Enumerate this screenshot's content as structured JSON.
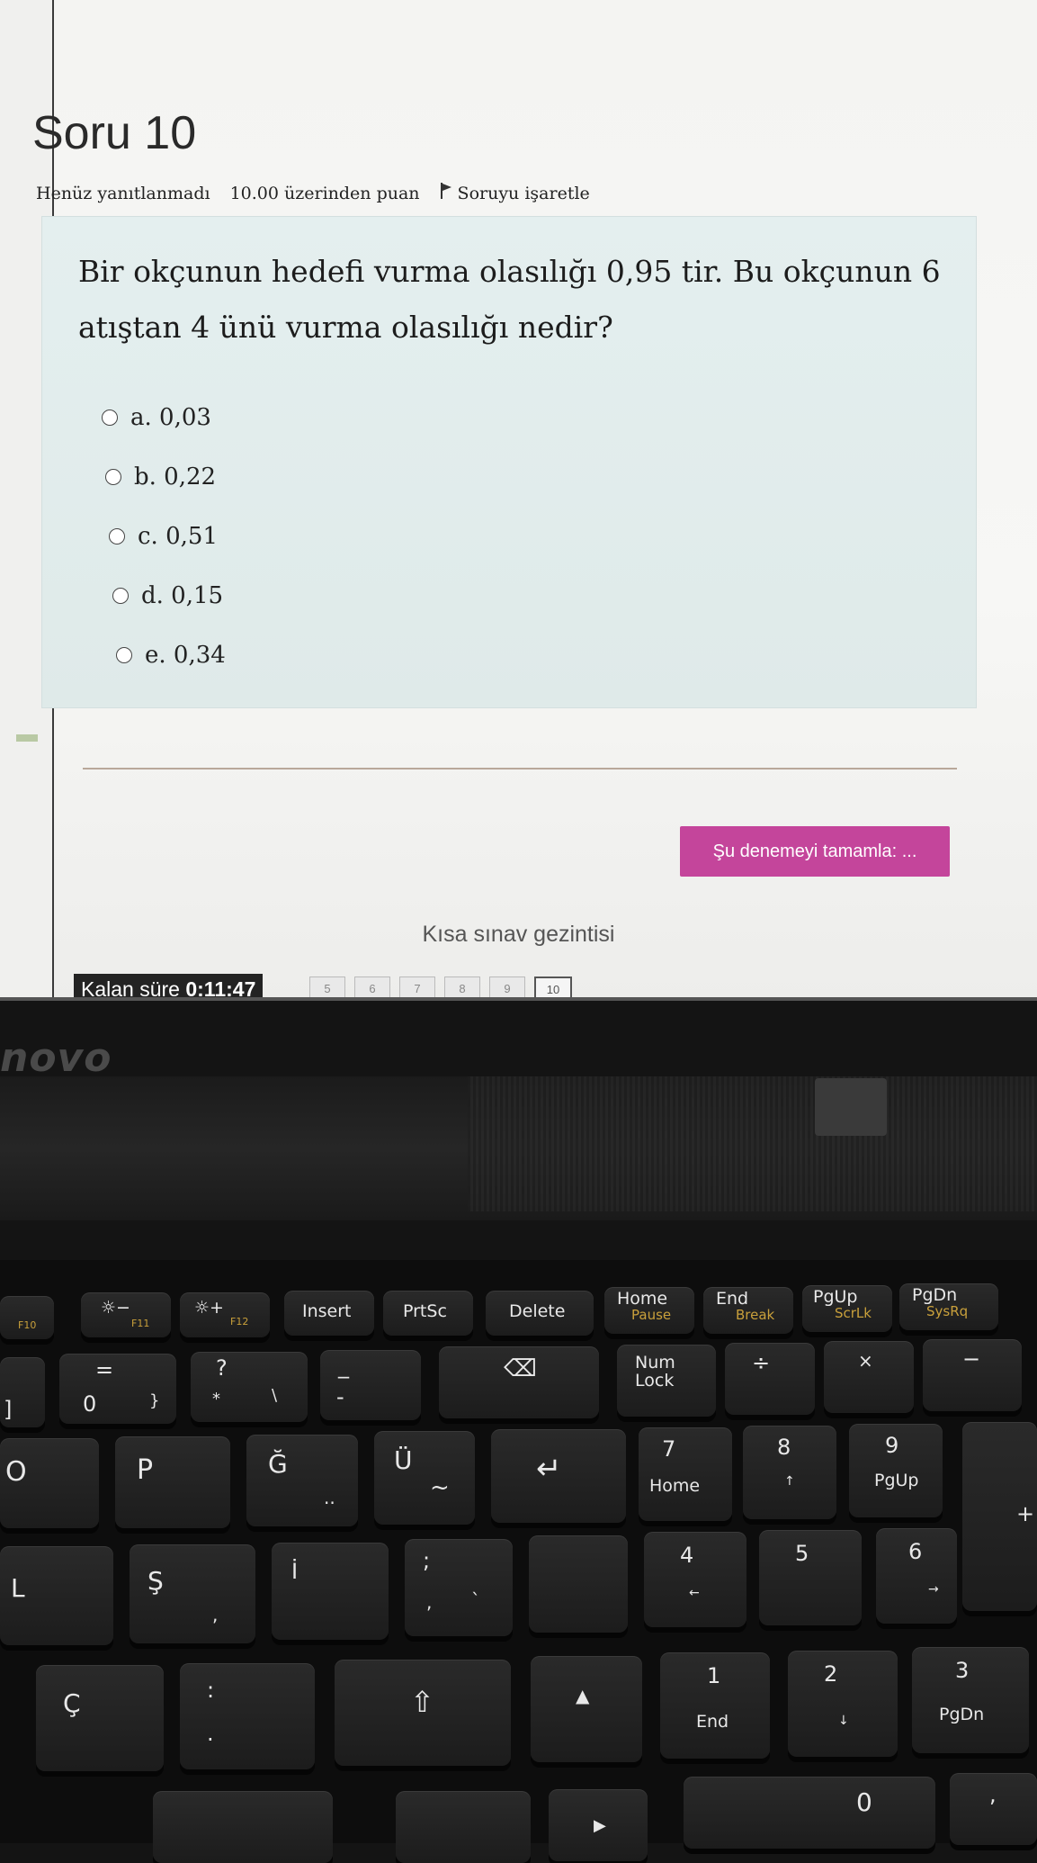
{
  "question": {
    "title": "Soru 10",
    "status": "Henüz yanıtlanmadı",
    "points": "10.00 üzerinden puan",
    "flag_label": "Soruyu işaretle",
    "text": "Bir okçunun hedefi vurma olasılığı 0,95 tir. Bu okçunun 6 atıştan 4 ünü vurma olasılığı nedir?",
    "answers": [
      {
        "label": "a. 0,03"
      },
      {
        "label": "b. 0,22"
      },
      {
        "label": "c. 0,51"
      },
      {
        "label": "d. 0,15"
      },
      {
        "label": "e. 0,34"
      }
    ]
  },
  "finish_button": "Şu denemeyi tamamla: ...",
  "quiz_nav": {
    "title": "Kısa sınav gezintisi",
    "timer_label": "Kalan süre",
    "timer_value": "0:11:47",
    "pages": [
      "5",
      "6",
      "7",
      "8",
      "9",
      "10"
    ]
  },
  "laptop": {
    "brand": "novo",
    "keys": {
      "f10": "F10",
      "f11": "F11",
      "f12": "F12",
      "insert": "Insert",
      "prtsc": "PrtSc",
      "delete": "Delete",
      "home_top": "Home",
      "pause": "Pause",
      "end_top": "End",
      "break": "Break",
      "pgup_top": "PgUp",
      "scrlk": "ScrLk",
      "pgdn_top": "PgDn",
      "sysrq": "SysRq",
      "eq": "=",
      "zero": "0",
      "brace1": "}",
      "q": "?",
      "star": "*",
      "bslash": "\\",
      "minus_top": "_",
      "dash": "-",
      "numlock": "Num Lock",
      "div": "÷",
      "mul": "×",
      "minus": "−",
      "o": "O",
      "p": "P",
      "gbreve": "Ğ",
      "udia": "Ü",
      "tilde": "~",
      "dots": "..",
      "n7": "7",
      "home": "Home",
      "n8": "8",
      "up": "↑",
      "n9": "9",
      "pgup": "PgUp",
      "plus": "+",
      "l": "L",
      "scedil": "Ş",
      "idot": "İ",
      "semi": ";",
      "comma": ",",
      "accent": "`",
      "n4": "4",
      "left": "←",
      "n5": "5",
      "n6": "6",
      "right": "→",
      "ccedil": "Ç",
      "colon": ":",
      "period": ".",
      "n1": "1",
      "end": "End",
      "n2": "2",
      "down": "↓",
      "n3": "3",
      "pgdn": "PgDn",
      "n0": "0",
      "numcomma": ","
    }
  }
}
